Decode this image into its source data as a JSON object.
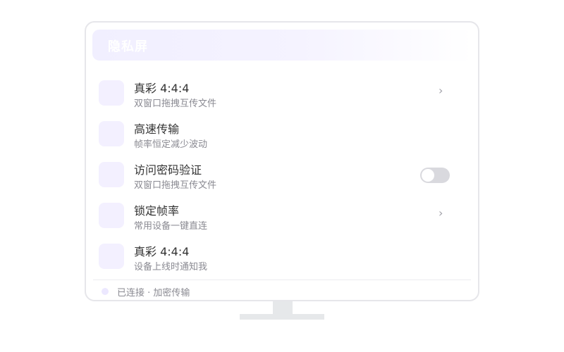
{
  "screen": {
    "title": "隐私屏"
  },
  "settings": {
    "items": [
      {
        "title": "真彩 4:4:4",
        "subtitle": "双窗口拖拽互传文件",
        "control": "chevron",
        "control_icon": "chevron-right-icon"
      },
      {
        "title": "高速传输",
        "subtitle": "帧率恒定减少波动",
        "control": "none"
      },
      {
        "title": "访问密码验证",
        "subtitle": "双窗口拖拽互传文件",
        "control": "toggle",
        "toggle_on": false
      },
      {
        "title": "锁定帧率",
        "subtitle": "常用设备一键直连",
        "control": "chevron",
        "control_icon": "chevron-right-icon"
      },
      {
        "title": "真彩 4:4:4",
        "subtitle": "设备上线时通知我",
        "control": "none"
      }
    ],
    "chevron_glyph": "›"
  },
  "footer": {
    "status_text": "已连接 · 加密传输"
  },
  "colors": {
    "accent_light": "#f3f0ff",
    "toggle_off": "#d9d9de",
    "border": "#e6e6ea"
  }
}
